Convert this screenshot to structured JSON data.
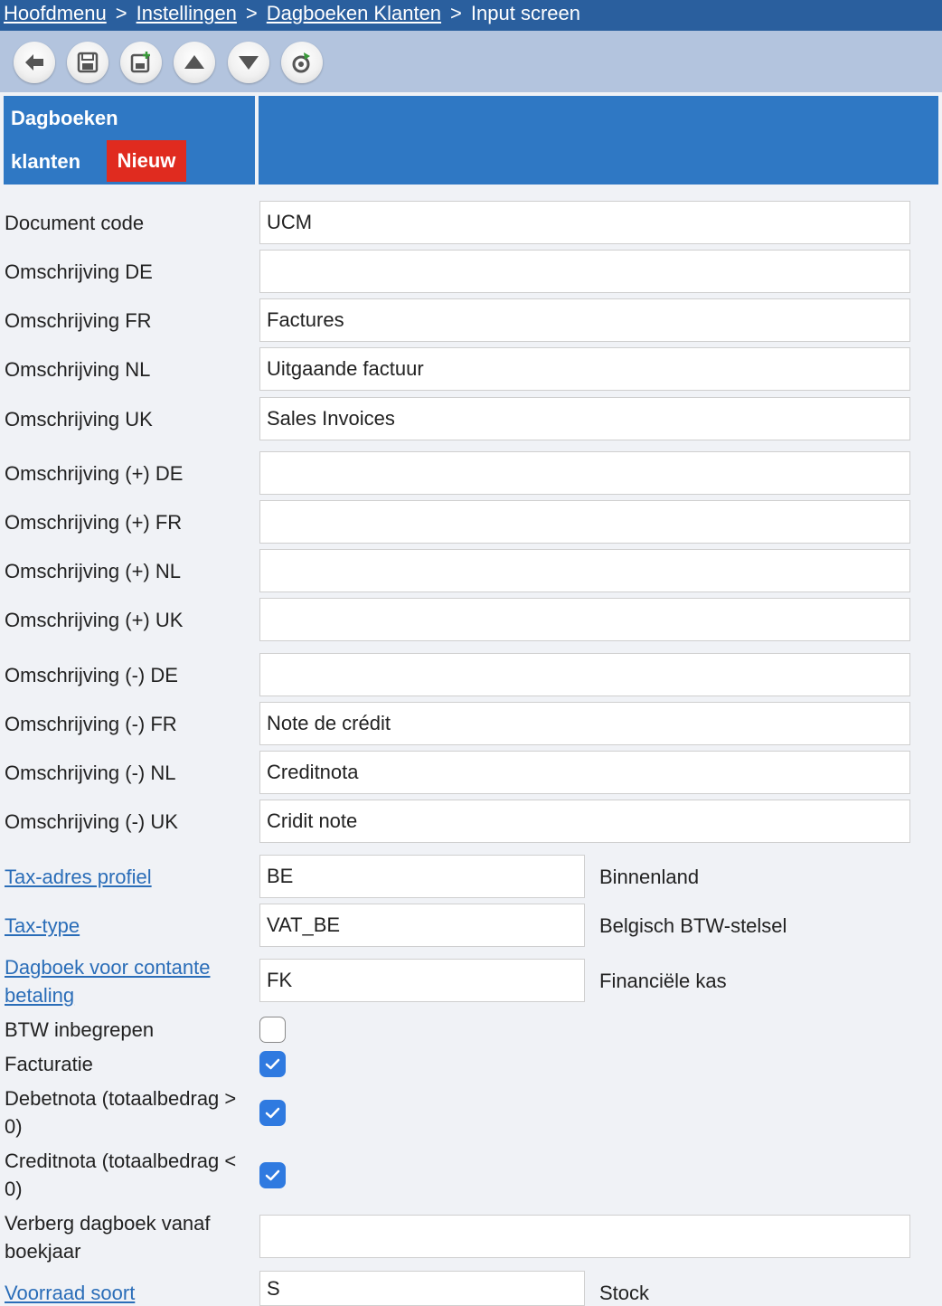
{
  "breadcrumb": {
    "items": [
      "Hoofdmenu",
      "Instellingen",
      "Dagboeken Klanten"
    ],
    "current": "Input screen",
    "separator": ">"
  },
  "toolbar": {
    "buttons": [
      "back-icon",
      "save-icon",
      "save-new-icon",
      "arrow-up-icon",
      "arrow-down-icon",
      "refresh-icon"
    ]
  },
  "header": {
    "title_line1": "Dagboeken",
    "title_line2": "klanten",
    "badge": "Nieuw",
    "badge_color": "#e02b1f",
    "accent_color": "#2f78c4"
  },
  "fields": {
    "document_code": {
      "label": "Document code",
      "value": "UCM"
    },
    "omschr_de": {
      "label": "Omschrijving DE",
      "value": ""
    },
    "omschr_fr": {
      "label": "Omschrijving FR",
      "value": "Factures"
    },
    "omschr_nl": {
      "label": "Omschrijving NL",
      "value": "Uitgaande factuur"
    },
    "omschr_uk": {
      "label": "Omschrijving UK",
      "value": "Sales Invoices"
    },
    "omschr_plus_de": {
      "label": "Omschrijving (+) DE",
      "value": ""
    },
    "omschr_plus_fr": {
      "label": "Omschrijving (+) FR",
      "value": ""
    },
    "omschr_plus_nl": {
      "label": "Omschrijving (+) NL",
      "value": ""
    },
    "omschr_plus_uk": {
      "label": "Omschrijving (+) UK",
      "value": ""
    },
    "omschr_min_de": {
      "label": "Omschrijving (-) DE",
      "value": ""
    },
    "omschr_min_fr": {
      "label": "Omschrijving (-) FR",
      "value": "Note de crédit"
    },
    "omschr_min_nl": {
      "label": "Omschrijving (-) NL",
      "value": "Creditnota"
    },
    "omschr_min_uk": {
      "label": "Omschrijving (-) UK",
      "value": "Cridit note"
    },
    "tax_adres": {
      "label": "Tax-adres profiel",
      "value": "BE",
      "description": "Binnenland"
    },
    "tax_type": {
      "label": "Tax-type",
      "value": "VAT_BE",
      "description": "Belgisch BTW-stelsel"
    },
    "dagboek_contant": {
      "label_line1": "Dagboek voor contante",
      "label_line2": "betaling",
      "value": "FK",
      "description": "Financiële kas"
    },
    "btw_inbegrepen": {
      "label": "BTW inbegrepen",
      "checked": false
    },
    "facturatie": {
      "label": "Facturatie",
      "checked": true
    },
    "debetnota": {
      "label_line1": "Debetnota (totaalbedrag >",
      "label_line2": "0)",
      "checked": true
    },
    "creditnota": {
      "label_line1": "Creditnota (totaalbedrag <",
      "label_line2": "0)",
      "checked": true
    },
    "verberg": {
      "label_line1": "Verberg dagboek vanaf",
      "label_line2": "boekjaar",
      "value": ""
    },
    "voorraad": {
      "label": "Voorraad soort",
      "value": "S",
      "description": "Stock"
    }
  }
}
